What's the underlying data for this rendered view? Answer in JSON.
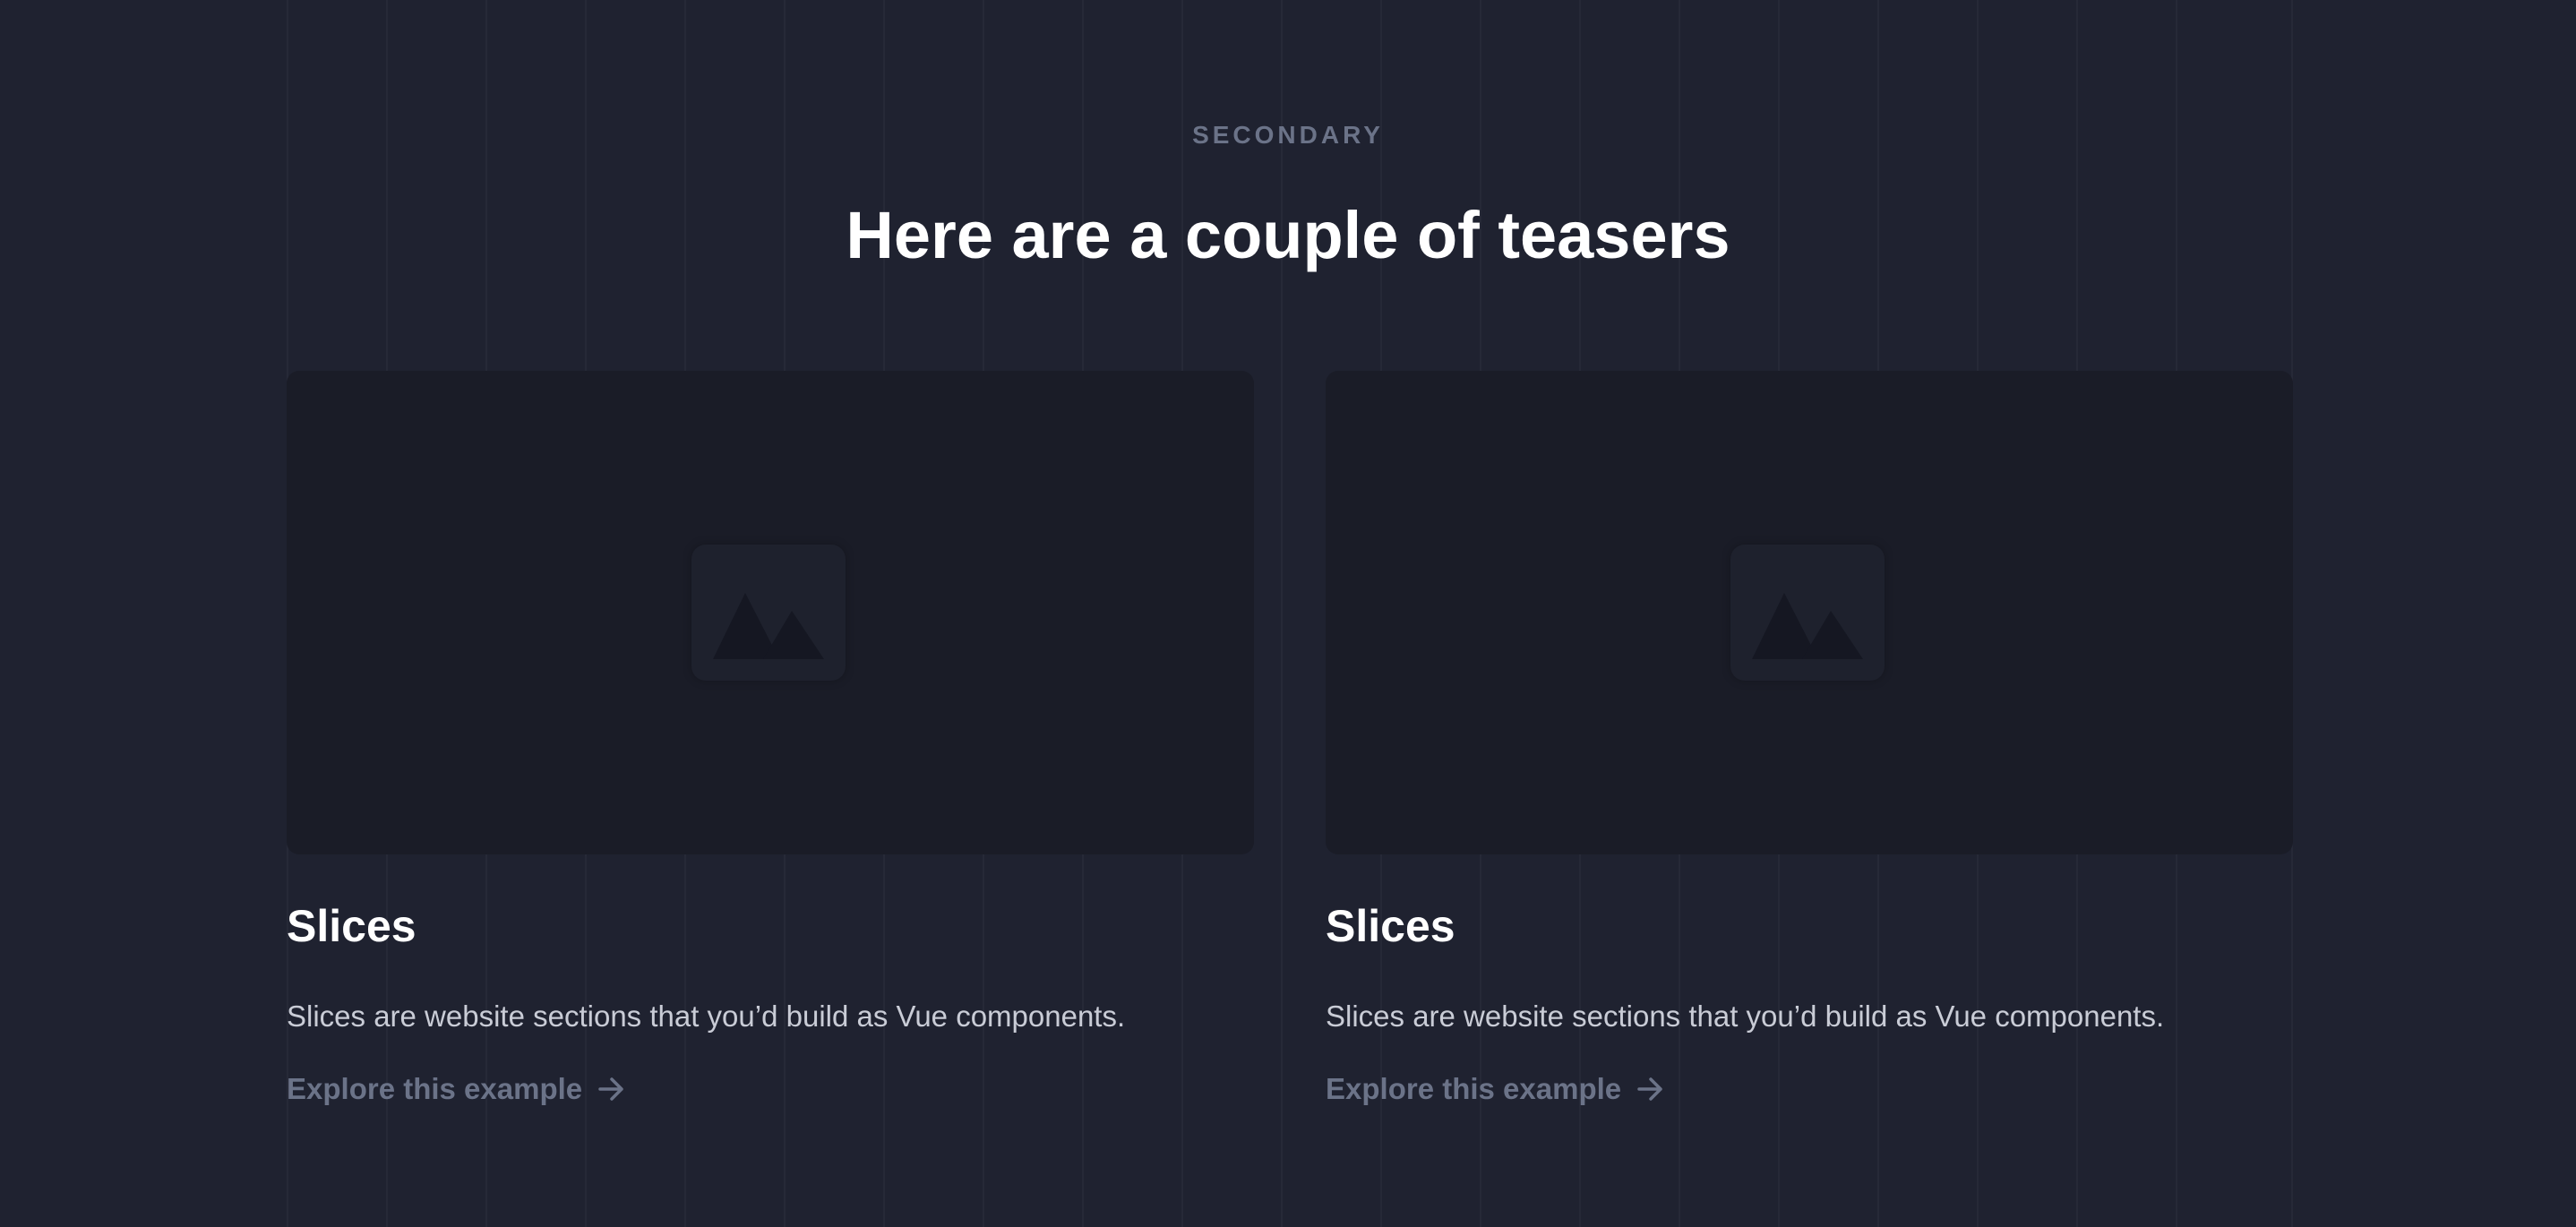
{
  "section": {
    "eyebrow": "SECONDARY",
    "heading": "Here are a couple of teasers"
  },
  "cards": [
    {
      "image_icon": "image-placeholder-icon",
      "title": "Slices",
      "description": "Slices are website sections that you’d build as Vue components.",
      "link_label": "Explore this example",
      "link_icon": "arrow-right-icon"
    },
    {
      "image_icon": "image-placeholder-icon",
      "title": "Slices",
      "description": "Slices are website sections that you’d build as Vue components.",
      "link_label": "Explore this example",
      "link_icon": "arrow-right-icon"
    }
  ],
  "colors": {
    "background": "#1f2230",
    "card_media": "#1a1c27",
    "heading": "#ffffff",
    "muted": "#6b7388",
    "body_text": "#c9ccd6"
  }
}
